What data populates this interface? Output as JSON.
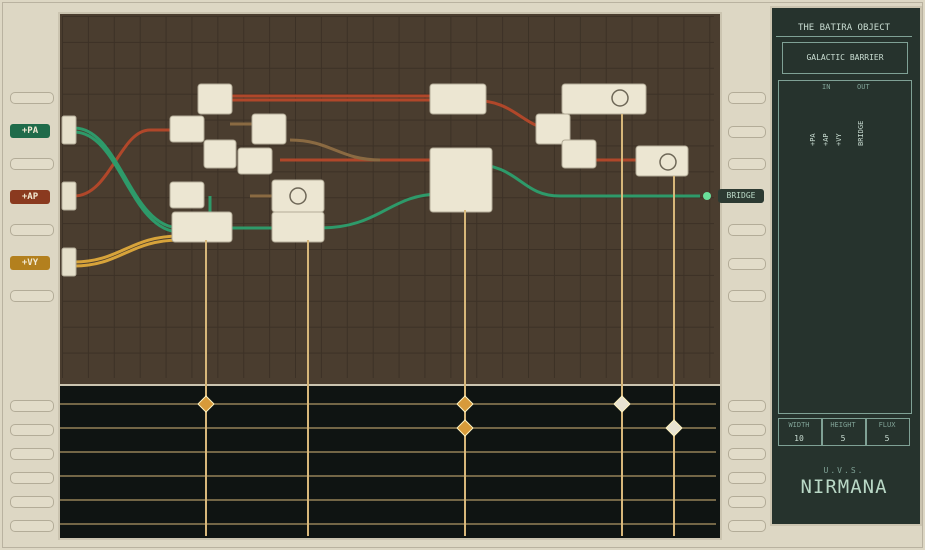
{
  "inputs": [
    {
      "label": "+PA",
      "color": "#1f6b4a"
    },
    {
      "label": "+AP",
      "color": "#8a3a1f"
    },
    {
      "label": "+VY",
      "color": "#b3801e"
    }
  ],
  "output": {
    "label": "BRIDGE"
  },
  "panel": {
    "title": "THE BATIRA OBJECT",
    "subtitle": "GALACTIC BARRIER",
    "in_label": "IN",
    "out_label": "OUT",
    "in_bars": [
      "+PA",
      "+AP",
      "+VY"
    ],
    "out_bars": [
      "BRIDGE"
    ],
    "stats": [
      {
        "label": "WIDTH",
        "value": "10"
      },
      {
        "label": "HEIGHT",
        "value": "5"
      },
      {
        "label": "FLUX",
        "value": "5"
      }
    ],
    "ship_prefix": "U.V.S.",
    "ship_name": "NIRMANA"
  },
  "colors": {
    "pa": "#2e9a6a",
    "ap": "#b0472a",
    "vy": "#d7a33a",
    "board": "#4a3d2f",
    "panel": "#26332d"
  }
}
